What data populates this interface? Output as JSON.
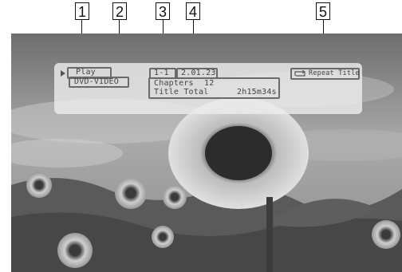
{
  "callouts": [
    "1",
    "2",
    "3",
    "4",
    "5"
  ],
  "osd": {
    "status": "Play",
    "disc_type": "DVD-VIDEO",
    "title_chapter": "1-1",
    "elapsed_time": "2.01.23",
    "chapters_label": "Chapters",
    "chapters_count": "12",
    "title_total_label": "Title Total",
    "title_total_time": "2h15m34s",
    "repeat_mode": "Repeat Title"
  },
  "icons": {
    "play": "play-arrow-icon",
    "repeat": "repeat-icon"
  },
  "colors": {
    "osd_background": "#ececec",
    "highlight_border": "#6a6a6a",
    "osd_text": "#444444"
  }
}
